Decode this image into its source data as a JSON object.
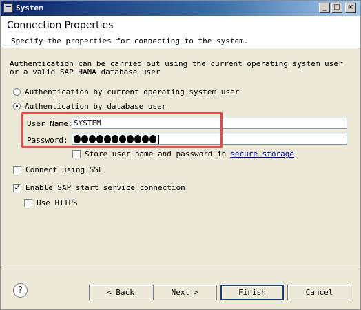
{
  "window": {
    "title": "System"
  },
  "header": {
    "title": "Connection Properties",
    "description": "Specify the properties for connecting to the system."
  },
  "intro_text": "Authentication can be carried out using the current operating system user or a valid SAP HANA database user",
  "auth": {
    "os_user_label": "Authentication by current operating system user",
    "db_user_label": "Authentication by database user",
    "selected": "db_user"
  },
  "credentials": {
    "user_name_label": "User Name:",
    "user_name_value": "SYSTEM",
    "password_label": "Password:",
    "password_masked_count": 11,
    "store_label": "Store user name and password in",
    "store_link": "secure storage",
    "store_checked": false
  },
  "options": {
    "ssl_label": "Connect using SSL",
    "ssl_checked": false,
    "sap_start_label": "Enable SAP start service connection",
    "sap_start_checked": true,
    "https_label": "Use HTTPS",
    "https_checked": false
  },
  "footer": {
    "help": "?",
    "back": "< Back",
    "next": "Next >",
    "finish": "Finish",
    "cancel": "Cancel"
  },
  "colors": {
    "highlight": "#e04b4b",
    "link": "#0000cc"
  }
}
